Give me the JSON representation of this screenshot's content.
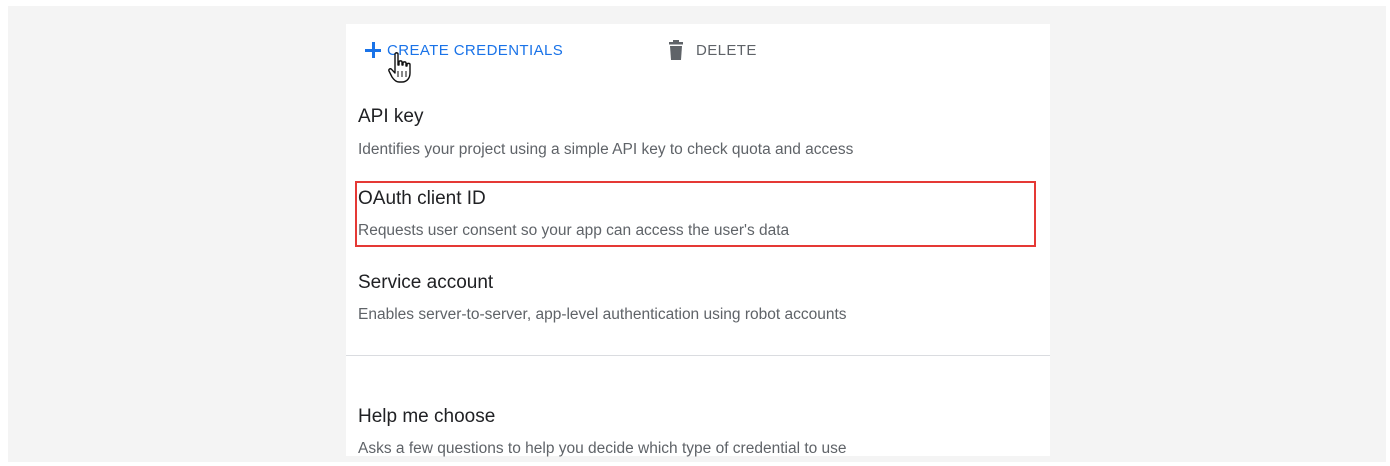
{
  "toolbar": {
    "create_label": "CREATE CREDENTIALS",
    "delete_label": "DELETE"
  },
  "menu": {
    "items": [
      {
        "title": "API key",
        "description": "Identifies your project using a simple API key to check quota and access"
      },
      {
        "title": "OAuth client ID",
        "description": "Requests user consent so your app can access the user's data"
      },
      {
        "title": "Service account",
        "description": "Enables server-to-server, app-level authentication using robot accounts"
      },
      {
        "title": "Help me choose",
        "description": "Asks a few questions to help you decide which type of credential to use"
      }
    ]
  },
  "colors": {
    "accent": "#1a73e8",
    "highlight_border": "#e53935"
  }
}
